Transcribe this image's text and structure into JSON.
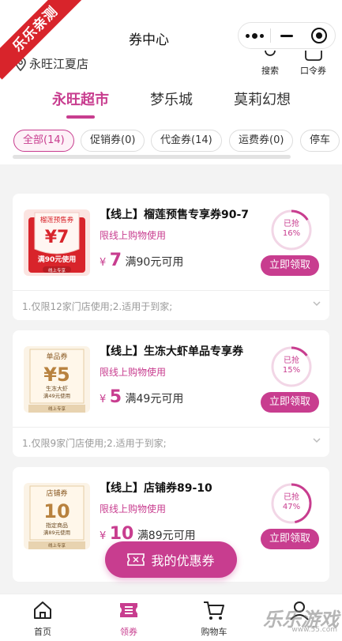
{
  "app": {
    "ribbon": "乐乐亲测",
    "title": "券中心",
    "store": "永旺江夏店",
    "search_label": "搜索",
    "password_label": "口令券"
  },
  "tabs": [
    {
      "label": "永旺超市"
    },
    {
      "label": "梦乐城"
    },
    {
      "label": "莫莉幻想"
    }
  ],
  "filters": [
    {
      "label": "全部(14)"
    },
    {
      "label": "促销券(0)"
    },
    {
      "label": "代金券(14)"
    },
    {
      "label": "运费券(0)"
    },
    {
      "label": "停车"
    }
  ],
  "coupons": [
    {
      "name": "【线上】榴莲预售专享券90-7",
      "limit": "限线上购物使用",
      "yen": "¥",
      "amount": "7",
      "cond": "满90元可用",
      "claimed_label": "已抢",
      "claimed_pct": "16%",
      "claimed_value": 0.16,
      "button": "立即领取",
      "note": "1.仅限12家门店使用;2.适用于到家;",
      "img": {
        "top_label": "榴莲预售券",
        "value": "¥7",
        "line1": "满90元使用",
        "line2": "",
        "footer": "线上专享",
        "theme": "red"
      }
    },
    {
      "name": "【线上】生冻大虾单品专享券",
      "limit": "限线上购物使用",
      "yen": "¥",
      "amount": "5",
      "cond": "满49元可用",
      "claimed_label": "已抢",
      "claimed_pct": "15%",
      "claimed_value": 0.15,
      "button": "立即领取",
      "note": "1.仅限9家门店使用;2.适用于到家;",
      "img": {
        "top_label": "单品券",
        "value": "¥5",
        "line1": "生冻大虾",
        "line2": "满49元使用",
        "footer": "线上专享",
        "theme": "gold"
      }
    },
    {
      "name": "【线上】店铺券89-10",
      "limit": "限线上购物使用",
      "yen": "¥",
      "amount": "10",
      "cond": "满89元可用",
      "claimed_label": "已抢",
      "claimed_pct": "47%",
      "claimed_value": 0.47,
      "button": "立即领取",
      "note": "",
      "img": {
        "top_label": "店铺券",
        "value": "10",
        "line1": "指定商品",
        "line2": "满89元使用",
        "footer": "线上专享",
        "theme": "gold"
      }
    }
  ],
  "my_coupons": "我的优惠券",
  "nav": [
    {
      "label": "首页"
    },
    {
      "label": "领券"
    },
    {
      "label": "购物车"
    },
    {
      "label": ""
    }
  ],
  "watermark": {
    "main": "乐乐游戏",
    "sub": "www.55.com"
  },
  "colors": {
    "accent": "#c83d8f",
    "red": "#d8242b",
    "gold": "#b8823f"
  }
}
